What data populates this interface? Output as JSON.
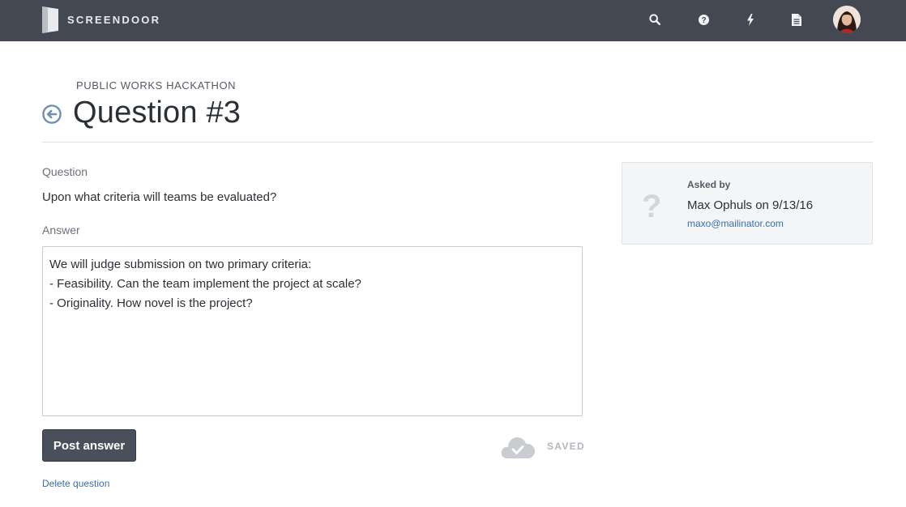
{
  "app": {
    "brand_name": "SCREENDOOR"
  },
  "nav": {
    "icons": [
      "search-icon",
      "help-icon",
      "lightning-icon",
      "document-icon"
    ],
    "avatar": "user-avatar"
  },
  "header": {
    "event_name": "PUBLIC WORKS HACKATHON",
    "title": "Question #3"
  },
  "question": {
    "label": "Question",
    "text": "Upon what criteria will teams be evaluated?"
  },
  "answer": {
    "label": "Answer",
    "lines": [
      "We will judge submission on two primary criteria:",
      "- Feasibility. Can the team implement the project at scale?",
      "- Originality. How novel is the project?"
    ]
  },
  "actions": {
    "post_label": "Post answer",
    "saved_label": "SAVED",
    "delete_label": "Delete question"
  },
  "asked_by": {
    "label": "Asked by",
    "name_date": "Max Ophuls on 9/13/16",
    "email": "maxo@mailinator.com",
    "placeholder_glyph": "?"
  },
  "colors": {
    "topbar": "#434852",
    "link": "#3a6fa8",
    "button": "#4a505b",
    "back_icon": "#6f8fb3"
  }
}
